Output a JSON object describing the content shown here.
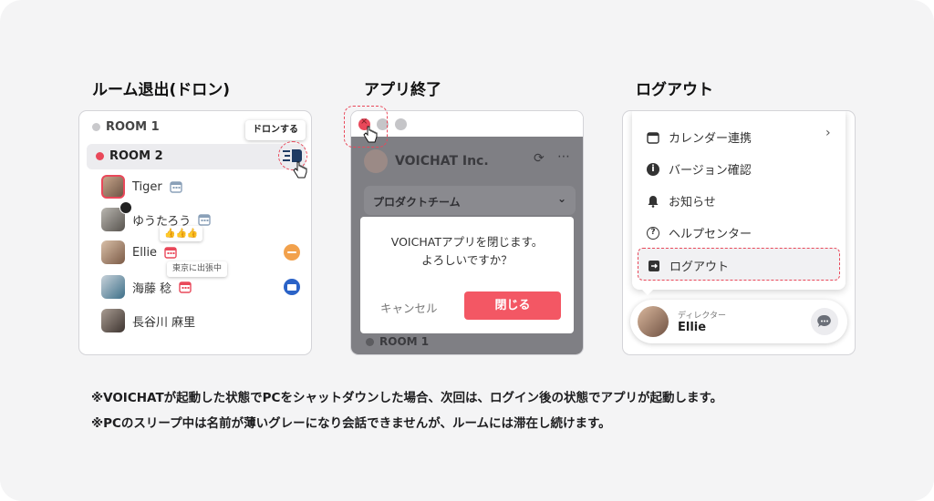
{
  "sections": {
    "room_leave": "ルーム退出(ドロン)",
    "app_quit": "アプリ終了",
    "logout": "ログアウト"
  },
  "panel1": {
    "room1": "ROOM 1",
    "room2": "ROOM 2",
    "tooltip": "ドロンする",
    "members": [
      {
        "name": "Tiger"
      },
      {
        "name": "ゆうたろう"
      },
      {
        "name": "Ellie"
      },
      {
        "name": "海藤 稔"
      },
      {
        "name": "長谷川 麻里"
      }
    ],
    "reaction": "👍👍👍",
    "location_badge": "東京に出張中",
    "colors": {
      "room2_dot": "#e9485a",
      "away": "#f2a14c",
      "busy": "#2b63c7"
    }
  },
  "panel2": {
    "company": "VOICHAT Inc.",
    "team": "プロダクトチーム",
    "dialog_line1": "VOICHATアプリを閉じます。",
    "dialog_line2": "よろしいですか？",
    "cancel": "キャンセル",
    "close": "閉じる",
    "room": "ROOM 1"
  },
  "panel3": {
    "menu": {
      "calendar": "カレンダー連携",
      "version": "バージョン確認",
      "notice": "お知らせ",
      "help": "ヘルプセンター",
      "logout": "ログアウト"
    },
    "user_role": "ディレクター",
    "user_name": "Ellie"
  },
  "notes": [
    "※VOICHATが起動した状態でPCをシャットダウンした場合、次回は、ログイン後の状態でアプリが起動します。",
    "※PCのスリープ中は名前が薄いグレーになり会話できませんが、ルームには滞在し続けます。"
  ]
}
